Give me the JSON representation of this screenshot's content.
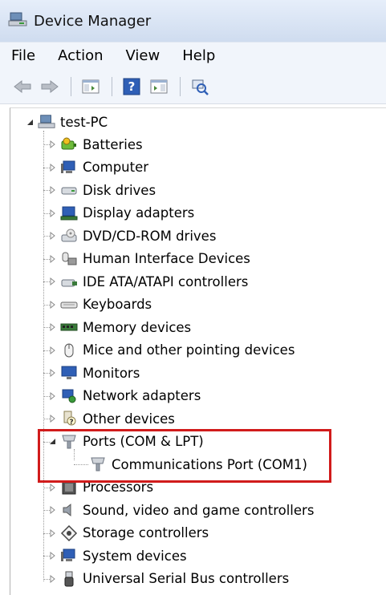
{
  "window": {
    "title": "Device Manager"
  },
  "menu": {
    "items": [
      "File",
      "Action",
      "View",
      "Help"
    ]
  },
  "toolbar": {
    "buttons": [
      "back-arrow-icon",
      "forward-arrow-icon",
      "show-hide-console-tree-icon",
      "help-icon",
      "properties-pane-icon",
      "scan-hardware-icon"
    ]
  },
  "tree": {
    "root": "test-PC",
    "items": [
      {
        "label": "Batteries",
        "icon": "battery-icon",
        "expanded": false
      },
      {
        "label": "Computer",
        "icon": "computer-icon",
        "expanded": false
      },
      {
        "label": "Disk drives",
        "icon": "disk-drive-icon",
        "expanded": false
      },
      {
        "label": "Display adapters",
        "icon": "display-adapter-icon",
        "expanded": false
      },
      {
        "label": "DVD/CD-ROM drives",
        "icon": "dvd-drive-icon",
        "expanded": false
      },
      {
        "label": "Human Interface Devices",
        "icon": "hid-icon",
        "expanded": false
      },
      {
        "label": "IDE ATA/ATAPI controllers",
        "icon": "ide-controller-icon",
        "expanded": false
      },
      {
        "label": "Keyboards",
        "icon": "keyboard-icon",
        "expanded": false
      },
      {
        "label": "Memory devices",
        "icon": "memory-icon",
        "expanded": false
      },
      {
        "label": "Mice and other pointing devices",
        "icon": "mouse-icon",
        "expanded": false
      },
      {
        "label": "Monitors",
        "icon": "monitor-icon",
        "expanded": false
      },
      {
        "label": "Network adapters",
        "icon": "network-adapter-icon",
        "expanded": false
      },
      {
        "label": "Other devices",
        "icon": "unknown-device-icon",
        "expanded": false
      },
      {
        "label": "Ports (COM & LPT)",
        "icon": "port-icon",
        "expanded": true
      },
      {
        "label": "Communications Port (COM1)",
        "icon": "port-icon",
        "child": true
      },
      {
        "label": "Processors",
        "icon": "processor-icon",
        "expanded": false
      },
      {
        "label": "Sound, video and game controllers",
        "icon": "sound-icon",
        "expanded": false
      },
      {
        "label": "Storage controllers",
        "icon": "storage-controller-icon",
        "expanded": false
      },
      {
        "label": "System devices",
        "icon": "system-devices-icon",
        "expanded": false
      },
      {
        "label": "Universal Serial Bus controllers",
        "icon": "usb-icon",
        "expanded": false
      }
    ]
  },
  "colors": {
    "highlight": "#d11b1b",
    "titlebar": "#dce6f4"
  }
}
